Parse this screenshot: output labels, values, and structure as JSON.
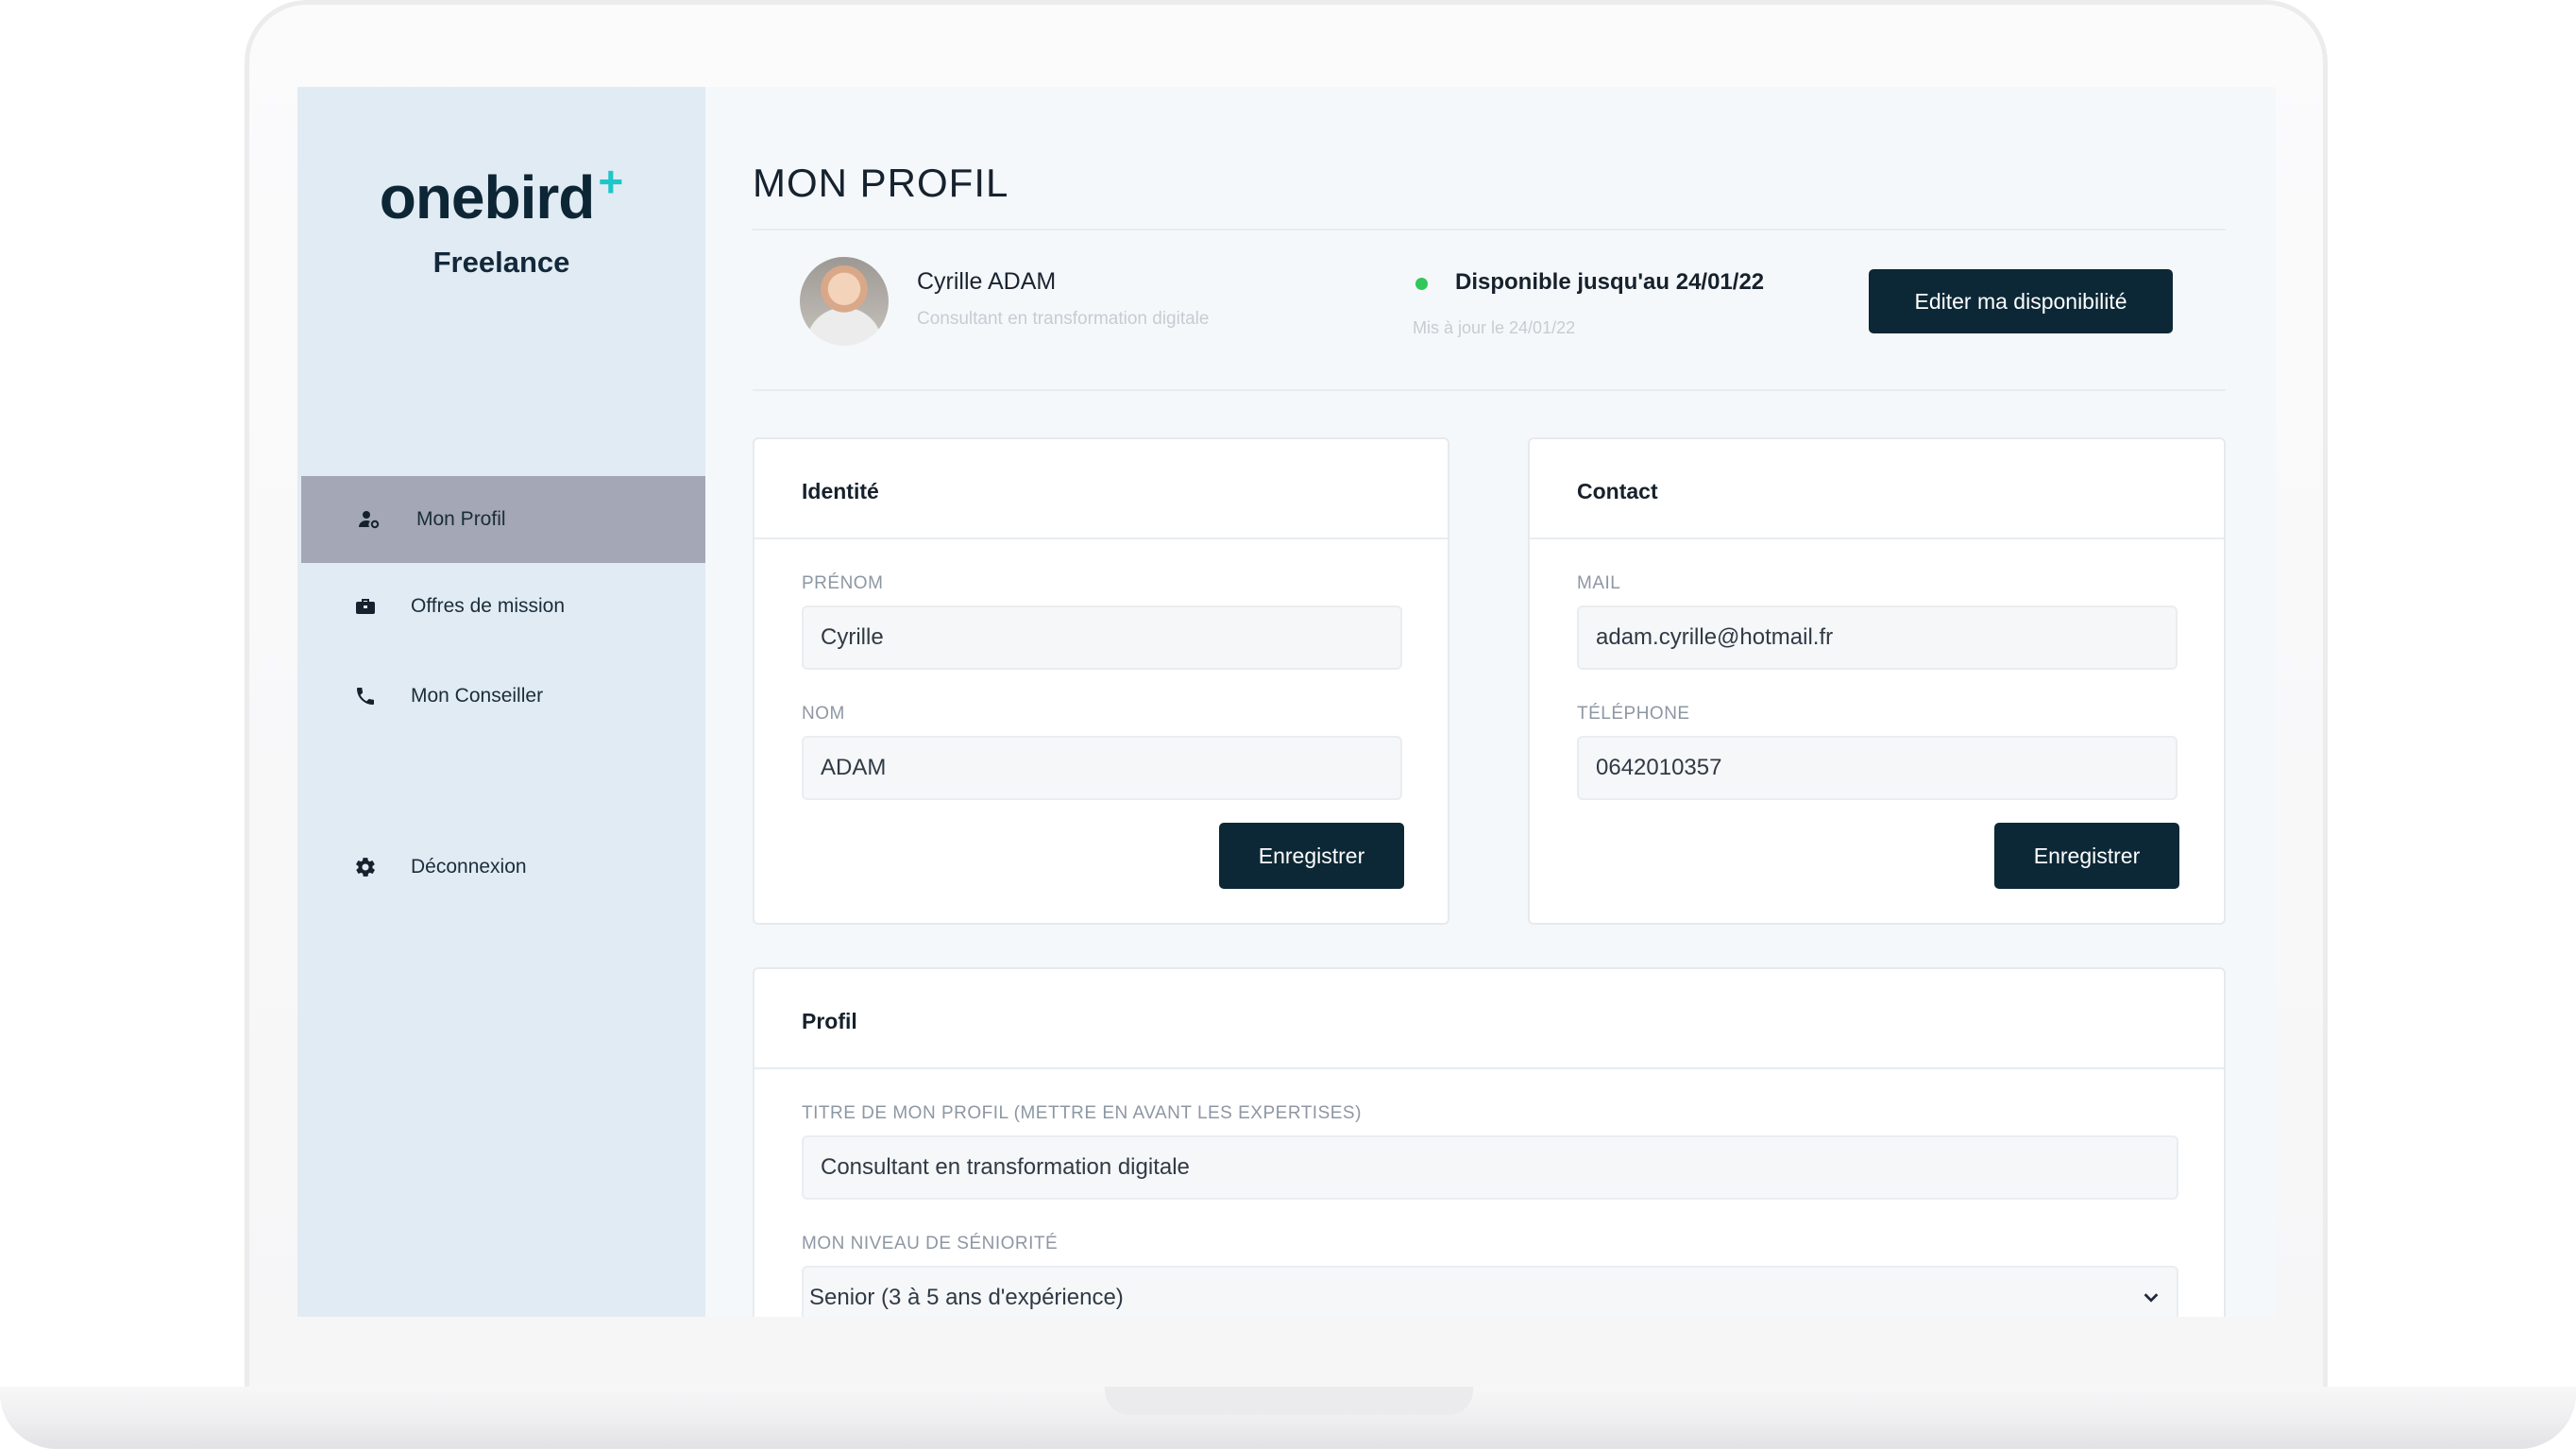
{
  "app": {
    "brand": "onebird",
    "brand_plus": "+",
    "brand_subtitle": "Freelance",
    "colors": {
      "dark": "#0c2836",
      "accent": "#1dc6c9",
      "sidebar": "#e1ebf3",
      "active_nav": "#a4a7b5",
      "available": "#31c75a"
    }
  },
  "sidebar": {
    "items": [
      {
        "label": "Mon Profil",
        "icon": "user-gear-icon",
        "active": true
      },
      {
        "label": "Offres de mission",
        "icon": "briefcase-icon",
        "active": false
      },
      {
        "label": "Mon Conseiller",
        "icon": "phone-icon",
        "active": false
      },
      {
        "label": "Déconnexion",
        "icon": "gear-icon",
        "active": false
      }
    ]
  },
  "header": {
    "title": "MON PROFIL",
    "user_name": "Cyrille ADAM",
    "user_role": "Consultant en transformation digitale",
    "availability": "Disponible jusqu'au 24/01/22",
    "availability_updated": "Mis à jour le 24/01/22",
    "edit_button": "Editer ma disponibilité"
  },
  "identity": {
    "title": "Identité",
    "firstname_label": "PRÉNOM",
    "firstname_value": "Cyrille",
    "lastname_label": "NOM",
    "lastname_value": "ADAM",
    "save": "Enregistrer"
  },
  "contact": {
    "title": "Contact",
    "mail_label": "MAIL",
    "mail_value": "adam.cyrille@hotmail.fr",
    "phone_label": "TÉLÉPHONE",
    "phone_value": "0642010357",
    "save": "Enregistrer"
  },
  "profile": {
    "title": "Profil",
    "headline_label": "TITRE DE MON PROFIL (METTRE EN AVANT LES EXPERTISES)",
    "headline_value": "Consultant en transformation digitale",
    "seniority_label": "MON NIVEAU DE SÉNIORITÉ",
    "seniority_value": "Senior (3 à 5 ans d'expérience)"
  }
}
